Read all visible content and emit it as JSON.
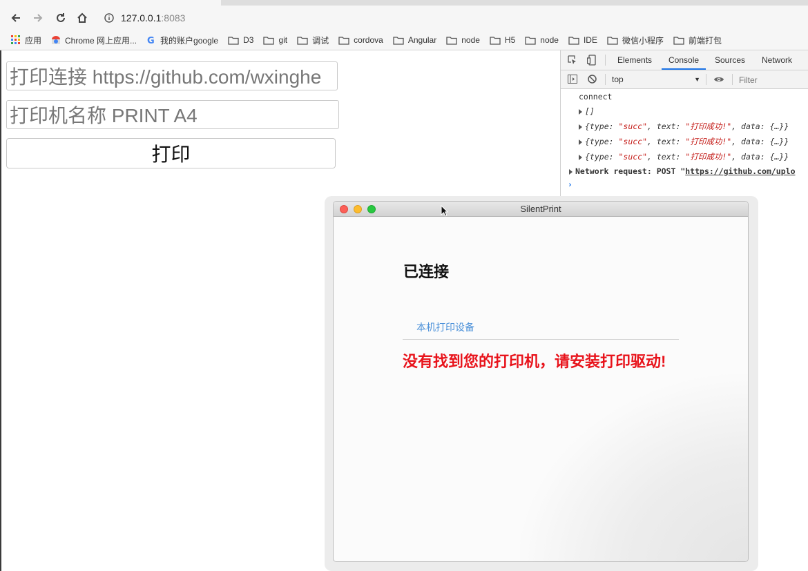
{
  "browser": {
    "address": "127.0.0.1",
    "port": ":8083",
    "nav_icons": [
      "back-arrow-icon",
      "forward-arrow-icon",
      "reload-icon",
      "home-icon"
    ],
    "bookmarks": [
      {
        "label": "应用",
        "icon": "apps-grid-icon"
      },
      {
        "label": "Chrome 网上应用...",
        "icon": "chrome-store-icon"
      },
      {
        "label": "我的账户google",
        "icon": "google-icon"
      },
      {
        "label": "D3",
        "icon": "folder-icon"
      },
      {
        "label": "git",
        "icon": "folder-icon"
      },
      {
        "label": "调试",
        "icon": "folder-icon"
      },
      {
        "label": "cordova",
        "icon": "folder-icon"
      },
      {
        "label": "Angular",
        "icon": "folder-icon"
      },
      {
        "label": "node",
        "icon": "folder-icon"
      },
      {
        "label": "H5",
        "icon": "folder-icon"
      },
      {
        "label": "node",
        "icon": "folder-icon"
      },
      {
        "label": "IDE",
        "icon": "folder-icon"
      },
      {
        "label": "微信小程序",
        "icon": "folder-icon"
      },
      {
        "label": "前端打包",
        "icon": "folder-icon"
      }
    ]
  },
  "page": {
    "url_input_value": "打印连接 https://github.com/wxinghe",
    "printer_input_value": "打印机名称 PRINT A4",
    "print_button": "打印"
  },
  "devtools": {
    "tabs": [
      "Elements",
      "Console",
      "Sources",
      "Network"
    ],
    "active_tab": "Console",
    "context": "top",
    "filter_placeholder": "Filter",
    "lines": {
      "connect": "connect",
      "empty_array": "[]",
      "obj_open": "{type: ",
      "type_val": "\"succ\"",
      "text_key": ", text: ",
      "text_val": "\"打印成功!\"",
      "data_tail": ", data: {…}}",
      "network": "Network request: POST \"",
      "network_url": "https://github.com/uplo"
    },
    "accent": "#1a73e8"
  },
  "app_window": {
    "title": "SilentPrint",
    "status": "已连接",
    "tab_label": "本机打印设备",
    "error": "没有找到您的打印机，请安装打印驱动!",
    "error_color": "#e8131b",
    "link_color": "#4a90d9"
  }
}
